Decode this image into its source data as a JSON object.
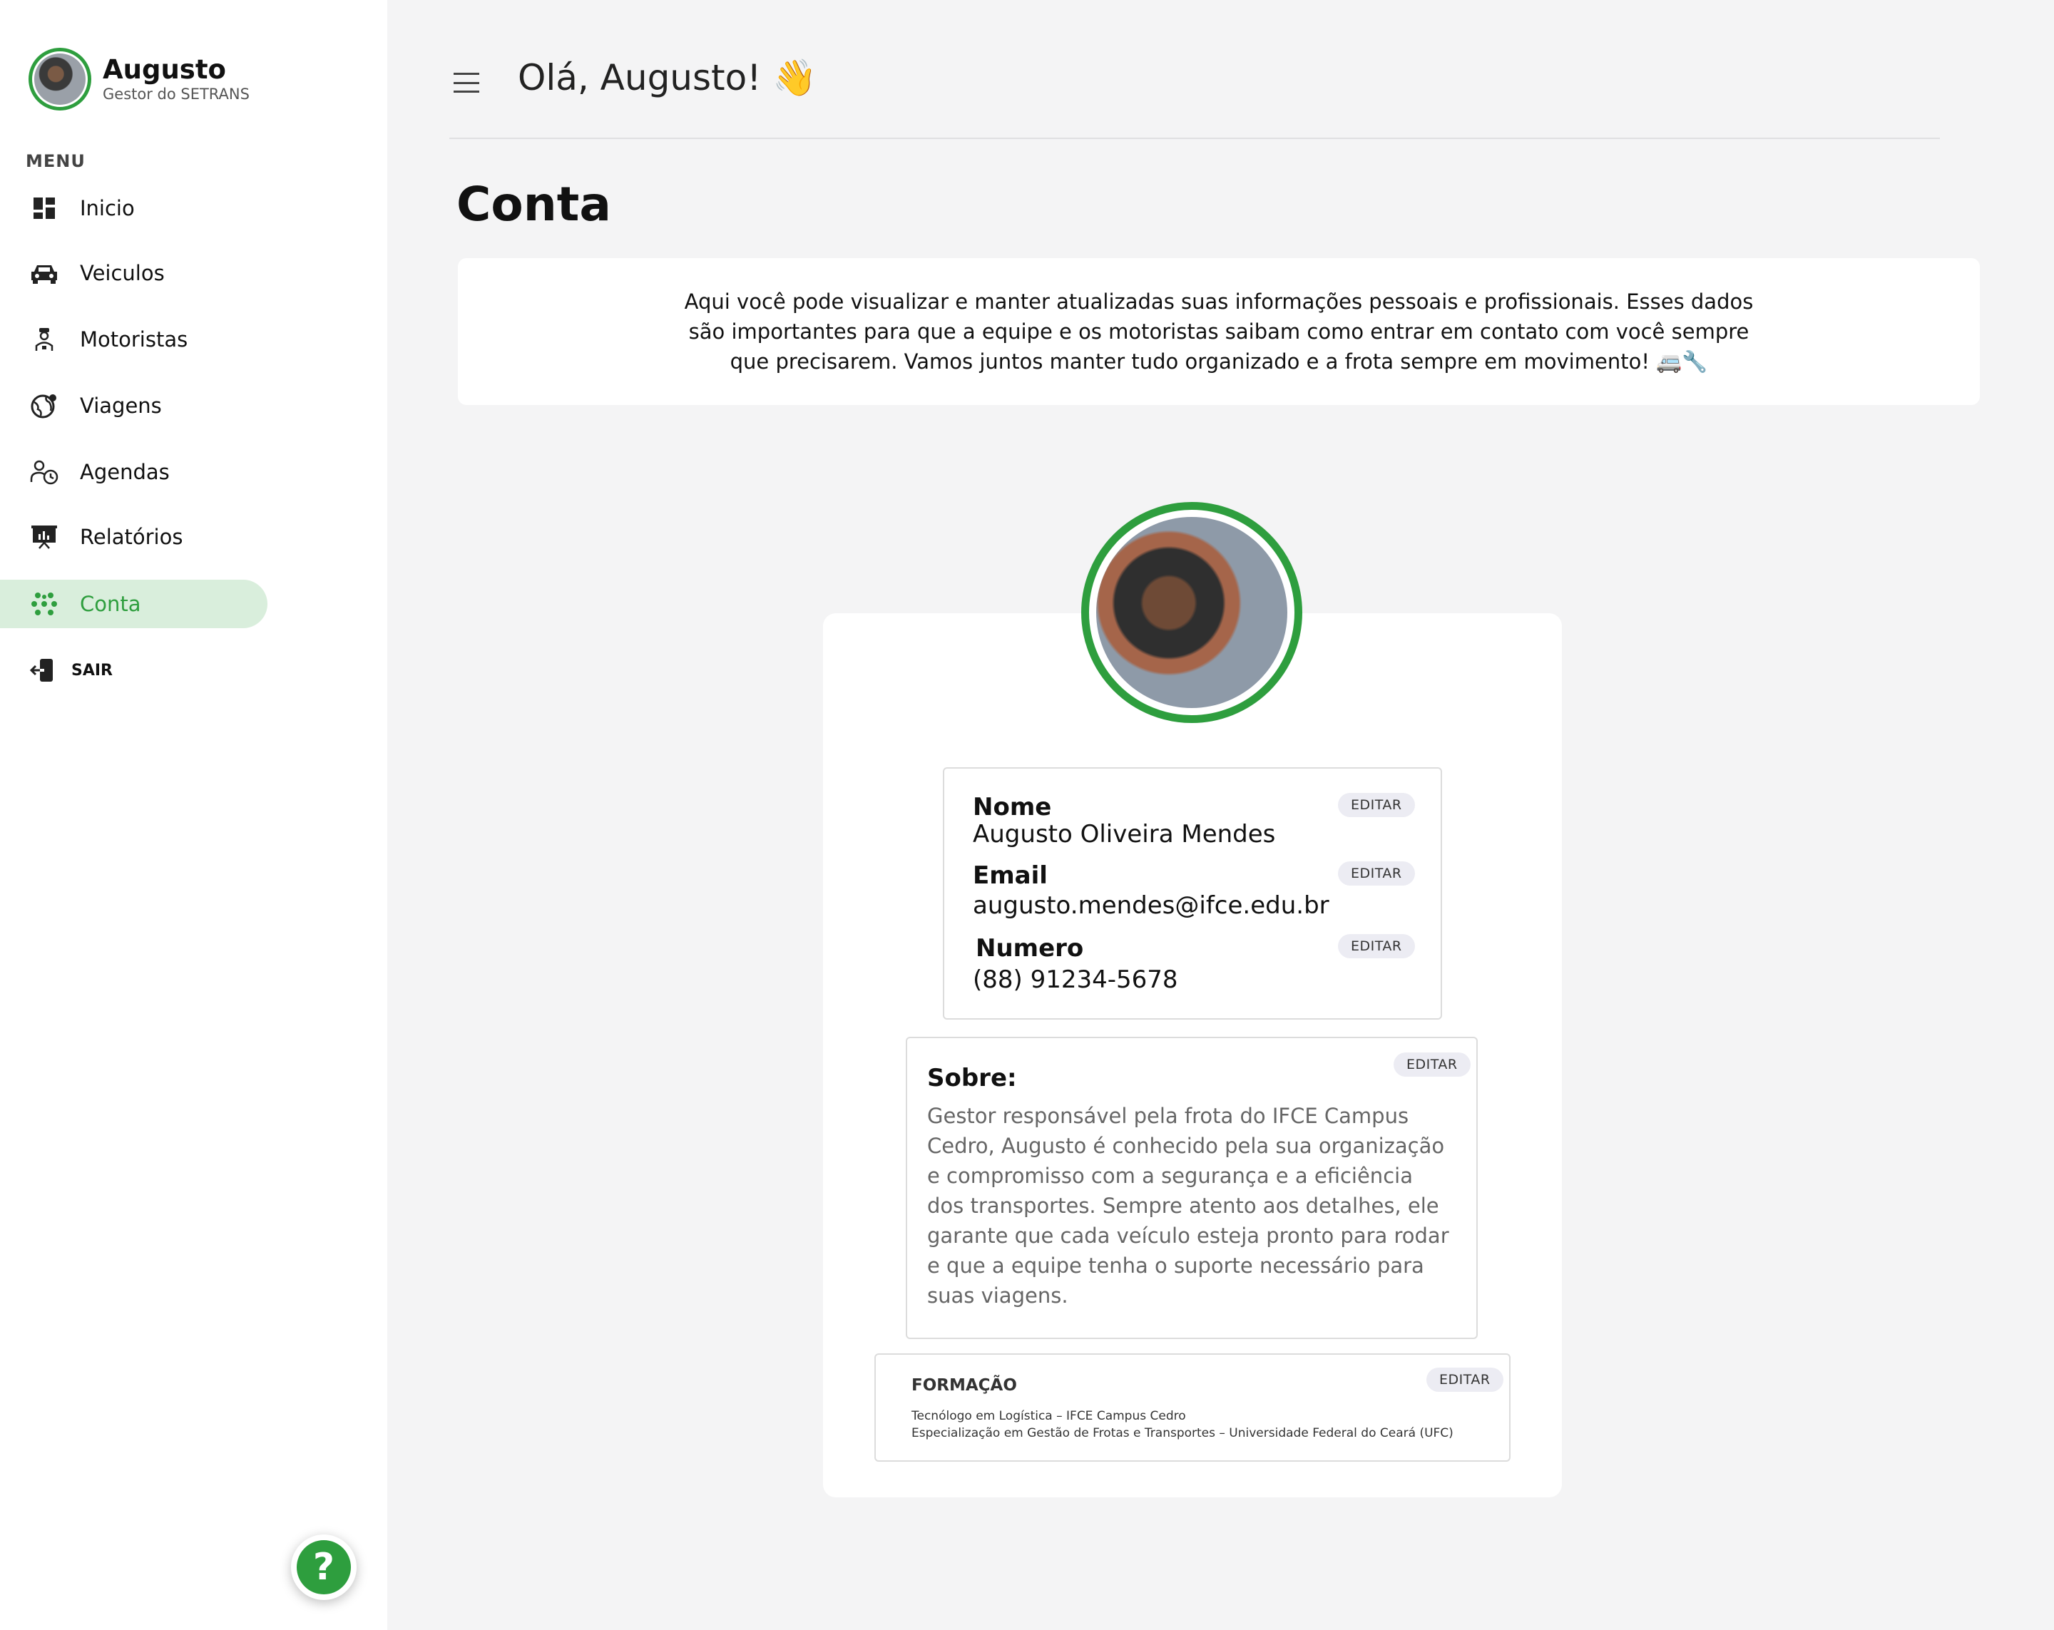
{
  "sidebar": {
    "user_name": "Augusto",
    "user_role": "Gestor do SETRANS",
    "menu_label": "MENU",
    "items": [
      {
        "label": "Inicio",
        "icon": "dashboard-icon"
      },
      {
        "label": "Veiculos",
        "icon": "car-icon"
      },
      {
        "label": "Motoristas",
        "icon": "driver-icon"
      },
      {
        "label": "Viagens",
        "icon": "globe-icon"
      },
      {
        "label": "Agendas",
        "icon": "schedule-icon"
      },
      {
        "label": "Relatórios",
        "icon": "presentation-chart-icon"
      },
      {
        "label": "Conta",
        "icon": "account-dots-icon",
        "active": true
      }
    ],
    "logout_label": "SAIR",
    "help_label": "?"
  },
  "header": {
    "greeting": "Olá, Augusto! 👋"
  },
  "page": {
    "title": "Conta",
    "intro": "Aqui você pode visualizar e manter atualizadas suas informações pessoais e profissionais. Esses dados são importantes para que a equipe e os motoristas saibam como entrar em contato com você sempre que precisarem. Vamos juntos manter tudo organizado e a frota sempre em movimento! 🚐🔧"
  },
  "account": {
    "edit_label": "EDITAR",
    "name_label": "Nome",
    "name_value": "Augusto Oliveira Mendes",
    "email_label": "Email",
    "email_value": "augusto.mendes@ifce.edu.br",
    "phone_label": "Numero",
    "phone_value": "(88) 91234-5678",
    "about_label": "Sobre:",
    "about_text": "Gestor responsável pela frota do IFCE Campus Cedro, Augusto é conhecido pela sua organização e compromisso com a segurança e a eficiência dos transportes. Sempre atento aos detalhes, ele garante que cada veículo esteja pronto para rodar e que a equipe tenha o suporte necessário para suas viagens.",
    "education_label": "FORMAÇÃO",
    "education": [
      "Tecnólogo em Logística – IFCE Campus Cedro",
      "Especialização em Gestão de Frotas e Transportes – Universidade Federal do Ceará (UFC)"
    ]
  },
  "colors": {
    "accent": "#2e9e3e",
    "active_bg": "#d9eedc",
    "background": "#f4f4f5"
  }
}
